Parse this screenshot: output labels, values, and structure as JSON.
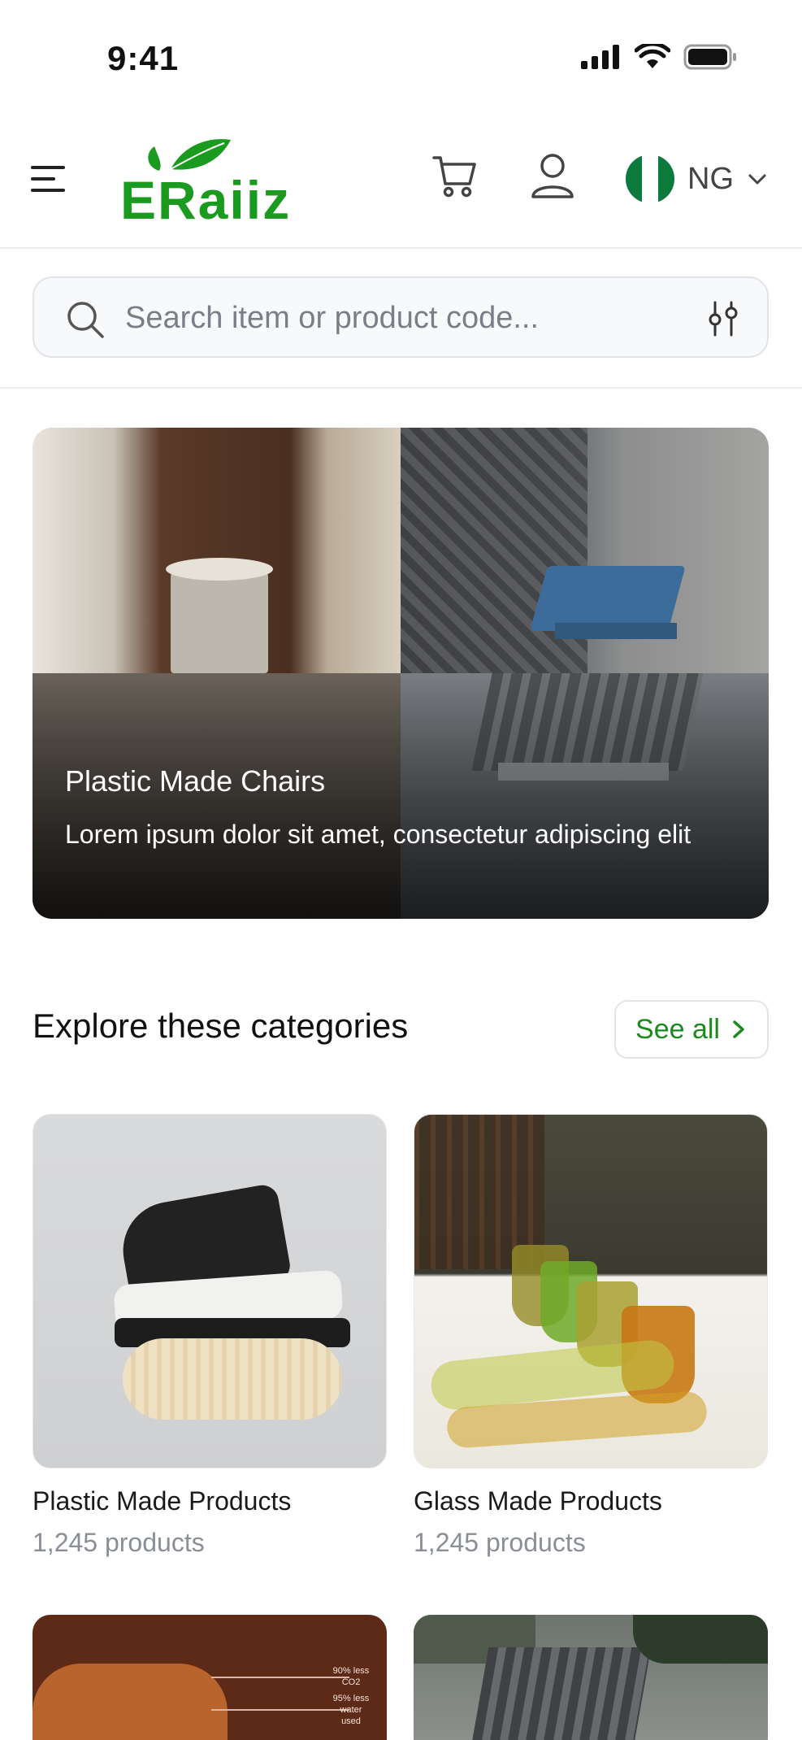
{
  "status_bar": {
    "time": "9:41"
  },
  "header": {
    "logo_text": "ERaiiz",
    "country_code": "NG",
    "colors": {
      "brand": "#1a9a1f",
      "flag_green": "#0b7a3c"
    }
  },
  "search": {
    "placeholder": "Search item or product code..."
  },
  "hero": {
    "title": "Plastic Made Chairs",
    "description": "Lorem ipsum dolor sit amet, consectetur adipiscing elit"
  },
  "categories": {
    "heading": "Explore these categories",
    "see_all_label": "See all",
    "items": [
      {
        "name": "Plastic Made Products",
        "count": "1,245 products"
      },
      {
        "name": "Glass Made Products",
        "count": "1,245 products"
      }
    ],
    "partial_card_text": [
      "90% less",
      "CO2",
      "95% less",
      "water",
      "used"
    ]
  },
  "icons": [
    "menu-icon",
    "cart-icon",
    "user-icon",
    "chevron-down-icon",
    "search-icon",
    "filter-icon",
    "chevron-right-icon",
    "signal-icon",
    "wifi-icon",
    "battery-icon"
  ]
}
